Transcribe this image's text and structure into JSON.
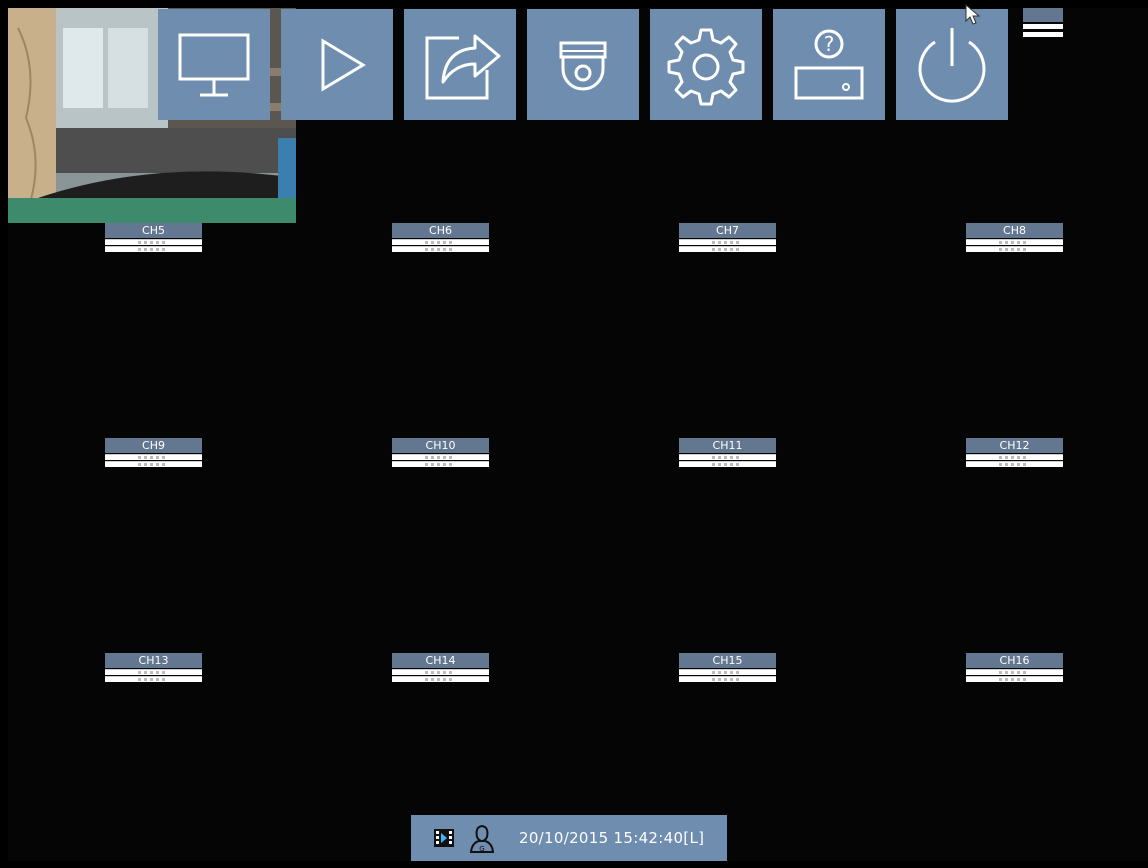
{
  "channels": [
    {
      "label": "CH5"
    },
    {
      "label": "CH6"
    },
    {
      "label": "CH7"
    },
    {
      "label": "CH8"
    },
    {
      "label": "CH9"
    },
    {
      "label": "CH10"
    },
    {
      "label": "CH11"
    },
    {
      "label": "CH12"
    },
    {
      "label": "CH13"
    },
    {
      "label": "CH14"
    },
    {
      "label": "CH15"
    },
    {
      "label": "CH16"
    }
  ],
  "menu": [
    {
      "name": "live-view",
      "icon": "monitor-icon"
    },
    {
      "name": "playback",
      "icon": "play-icon"
    },
    {
      "name": "export",
      "icon": "export-icon"
    },
    {
      "name": "ptz",
      "icon": "dome-camera-icon"
    },
    {
      "name": "setup",
      "icon": "gear-icon"
    },
    {
      "name": "system-info",
      "icon": "device-help-icon"
    },
    {
      "name": "shutdown",
      "icon": "power-icon"
    }
  ],
  "status": {
    "datetime": "20/10/2015 15:42:40[L]"
  },
  "colors": {
    "menu_bg": "#6e8daf",
    "label_bg": "#637890",
    "background": "#050505"
  }
}
